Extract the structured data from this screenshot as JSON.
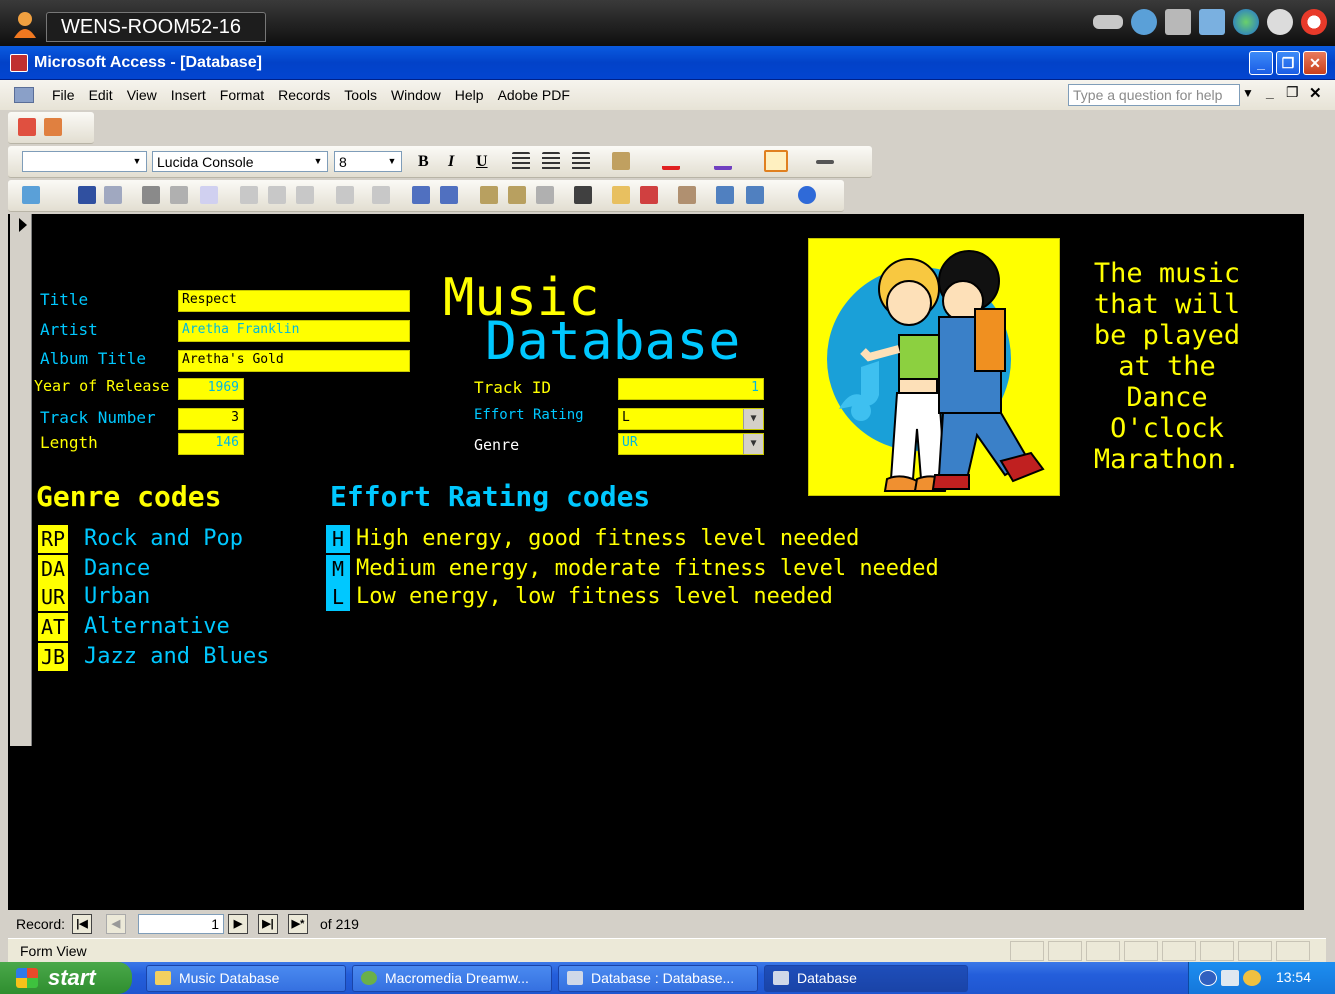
{
  "host": {
    "machine_name": "WENS-ROOM52-16"
  },
  "app": {
    "title": "Microsoft Access - [Database]"
  },
  "menu": {
    "items": [
      "File",
      "Edit",
      "View",
      "Insert",
      "Format",
      "Records",
      "Tools",
      "Window",
      "Help",
      "Adobe PDF"
    ],
    "help_placeholder": "Type a question for help"
  },
  "toolbar": {
    "font_name": "Lucida Console",
    "font_size": "8",
    "bold": "B",
    "italic": "I",
    "underline": "U"
  },
  "form": {
    "heading_line1": "Music",
    "heading_line2": "Database",
    "side_text": "The music\nthat will\nbe played\nat the\nDance\nO'clock\nMarathon.",
    "fields": {
      "title": {
        "label": "Title",
        "value": "Respect"
      },
      "artist": {
        "label": "Artist",
        "value": "Aretha Franklin"
      },
      "album": {
        "label": "Album Title",
        "value": "Aretha's Gold"
      },
      "year": {
        "label": "Year of Release",
        "value": "1969"
      },
      "track_number": {
        "label": "Track Number",
        "value": "3"
      },
      "length": {
        "label": "Length",
        "value": "146"
      },
      "track_id": {
        "label": "Track ID",
        "value": "1"
      },
      "effort": {
        "label": "Effort Rating",
        "value": "L"
      },
      "genre": {
        "label": "Genre",
        "value": "UR"
      }
    },
    "genre_codes": {
      "heading": "Genre codes",
      "items": [
        {
          "code": "RP",
          "name": "Rock and Pop"
        },
        {
          "code": "DA",
          "name": "Dance"
        },
        {
          "code": "UR",
          "name": "Urban"
        },
        {
          "code": "AT",
          "name": "Alternative"
        },
        {
          "code": "JB",
          "name": "Jazz and Blues"
        }
      ]
    },
    "effort_codes": {
      "heading": "Effort Rating codes",
      "items": [
        {
          "code": "H",
          "name": "High energy, good fitness level needed"
        },
        {
          "code": "M",
          "name": "Medium energy, moderate fitness level needed"
        },
        {
          "code": "L",
          "name": "Low energy, low fitness level needed"
        }
      ]
    }
  },
  "navigation": {
    "label": "Record:",
    "current": "1",
    "of_text": "of 219"
  },
  "status": {
    "text": "Form View"
  },
  "taskbar": {
    "start": "start",
    "tasks": [
      "Music Database",
      "Macromedia Dreamw...",
      "Database : Database...",
      "Database"
    ],
    "clock": "13:54"
  },
  "colors": {
    "form_bg": "#000000",
    "accent_yellow": "#ffff00",
    "accent_cyan": "#00c8ff"
  }
}
